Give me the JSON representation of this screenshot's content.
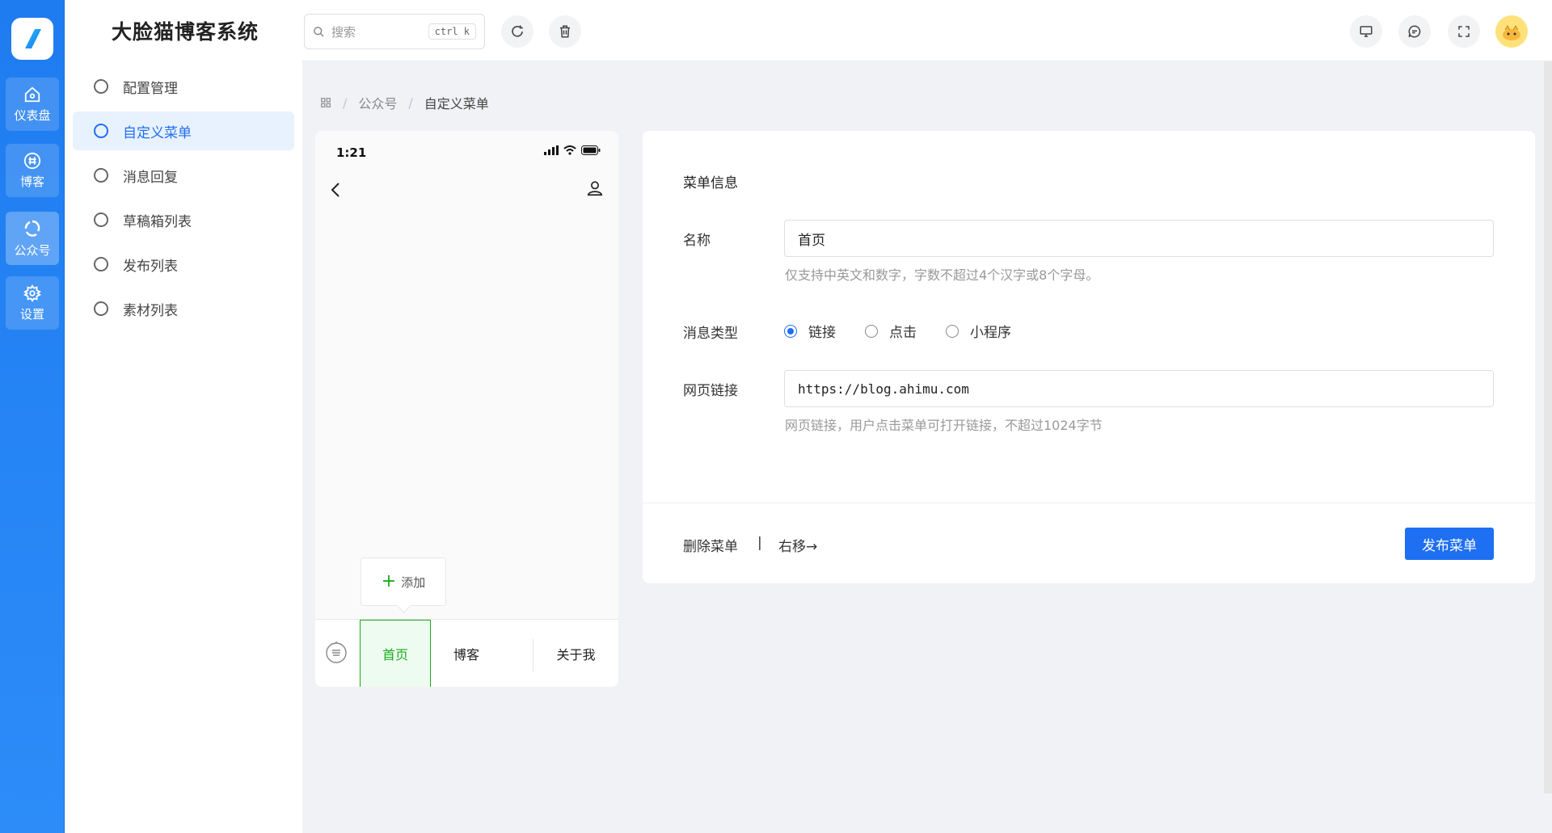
{
  "app": {
    "brand_title": "大脸猫博客系统"
  },
  "rail": {
    "items": [
      {
        "label": "仪表盘",
        "icon": "home-icon"
      },
      {
        "label": "博客",
        "icon": "hash-icon"
      },
      {
        "label": "公众号",
        "icon": "wechat-icon",
        "active": true
      },
      {
        "label": "设置",
        "icon": "gear-icon"
      }
    ]
  },
  "subnav": {
    "items": [
      {
        "label": "配置管理"
      },
      {
        "label": "自定义菜单",
        "active": true
      },
      {
        "label": "消息回复"
      },
      {
        "label": "草稿箱列表"
      },
      {
        "label": "发布列表"
      },
      {
        "label": "素材列表"
      }
    ]
  },
  "header": {
    "search_placeholder": "搜索",
    "search_shortcut": "ctrl k"
  },
  "breadcrumb": {
    "items": [
      "公众号",
      "自定义菜单"
    ]
  },
  "phone": {
    "time": "1:21",
    "add_label": "添加",
    "tabs": [
      "首页",
      "博客",
      "关于我"
    ]
  },
  "form": {
    "section_title": "菜单信息",
    "name_label": "名称",
    "name_value": "首页",
    "name_hint": "仅支持中英文和数字，字数不超过4个汉字或8个字母。",
    "type_label": "消息类型",
    "type_options": [
      "链接",
      "点击",
      "小程序"
    ],
    "type_selected": "链接",
    "url_label": "网页链接",
    "url_value": "https://blog.ahimu.com",
    "url_hint": "网页链接，用户点击菜单可打开链接，不超过1024字节",
    "delete_label": "删除菜单",
    "separator": "|",
    "move_right_label": "右移→",
    "publish_label": "发布菜单"
  },
  "colors": {
    "primary": "#1e6ff2",
    "rail": "#1e7cf0",
    "wechat_green": "#1aad19"
  }
}
